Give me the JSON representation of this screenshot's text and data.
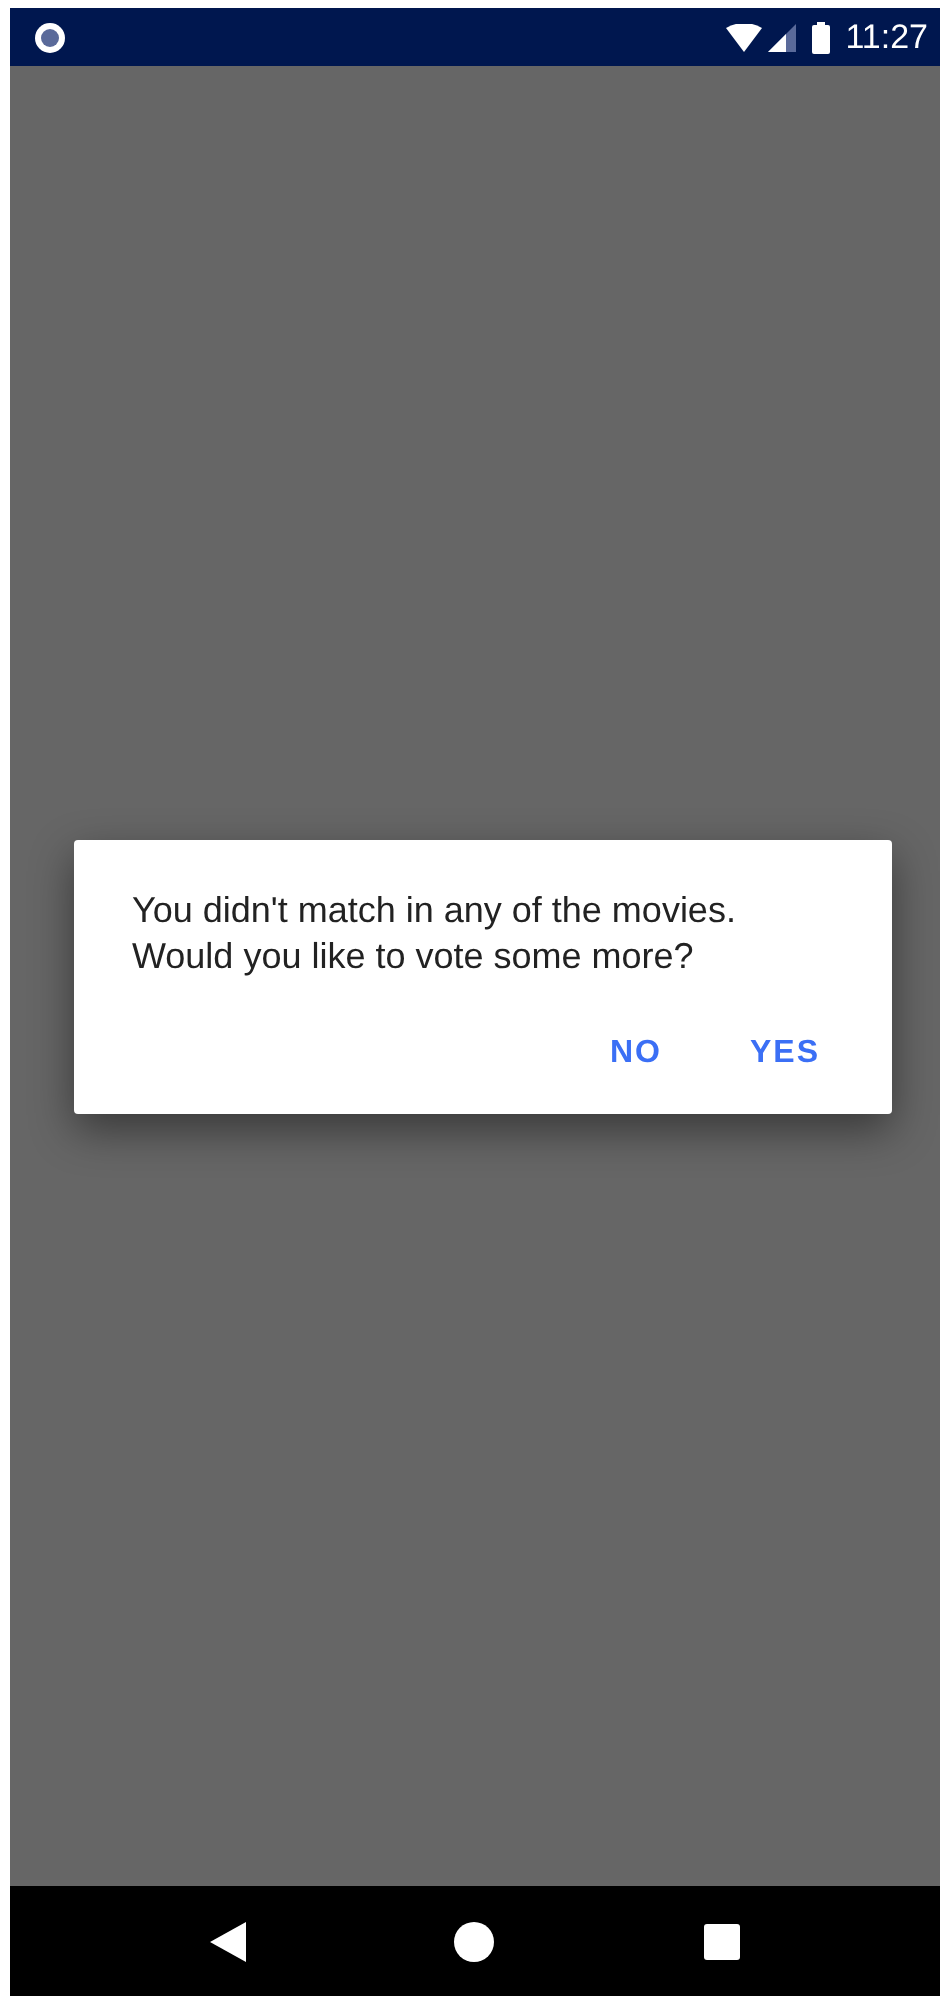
{
  "status_bar": {
    "time": "11:27"
  },
  "dialog": {
    "message": "You didn't match in any of the movies.\nWould you like to vote some more?",
    "buttons": [
      {
        "label": "NO"
      },
      {
        "label": "YES"
      }
    ]
  }
}
